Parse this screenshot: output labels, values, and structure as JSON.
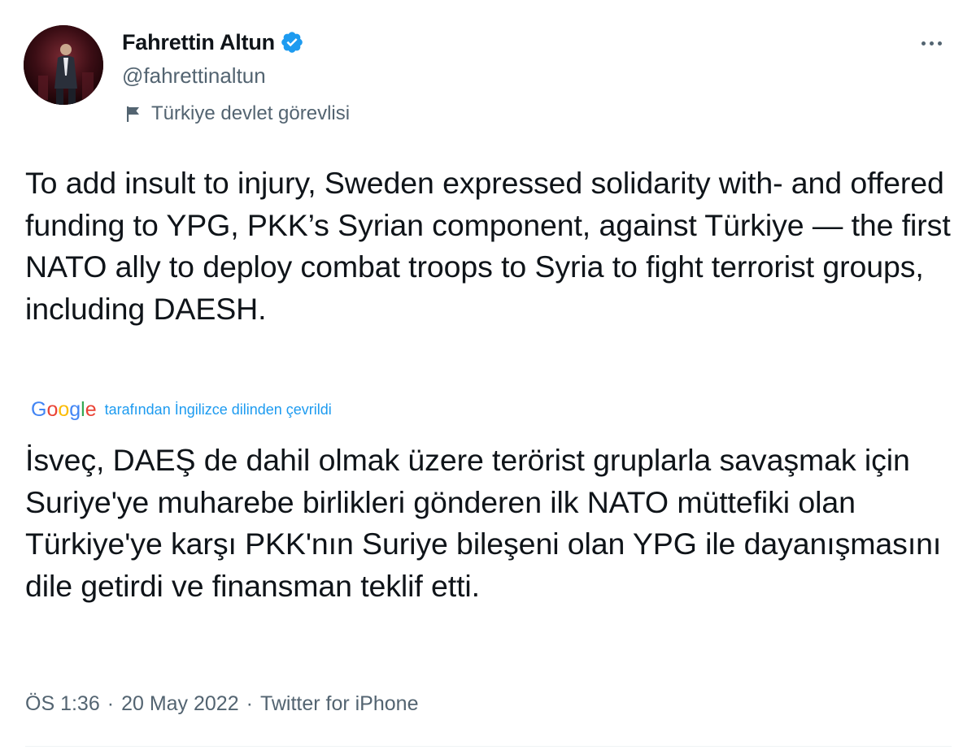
{
  "author": {
    "display_name": "Fahrettin Altun",
    "handle": "@fahrettinaltun",
    "verified": true,
    "account_label": "Türkiye devlet görevlisi"
  },
  "tweet": {
    "text": "To add insult to injury, Sweden expressed solidarity with- and offered funding to YPG, PKK’s Syrian component, against Türkiye — the first NATO ally to deploy combat troops to Syria to fight terrorist groups, including DAESH.",
    "translation_provider": "Google",
    "translation_note": "tarafından İngilizce dilinden çevrildi",
    "translated_text": "İsveç, DAEŞ de dahil olmak üzere terörist gruplarla savaşmak için Suriye'ye muharebe birlikleri gönderen ilk NATO müttefiki olan Türkiye'ye karşı PKK'nın Suriye bileşeni olan YPG ile dayanışmasını dile getirdi ve finansman teklif etti.",
    "time": "ÖS 1:36",
    "date": "20 May 2022",
    "source": "Twitter for iPhone",
    "separator": "·"
  },
  "colors": {
    "text_primary": "#0f1419",
    "text_secondary": "#536471",
    "accent": "#1d9bf0",
    "verified_badge": "#1d9bf0",
    "avatar_background": "#3a0d14"
  },
  "icons": {
    "verified": "verified-badge-icon",
    "label": "flag-icon",
    "more": "more-options-icon"
  }
}
